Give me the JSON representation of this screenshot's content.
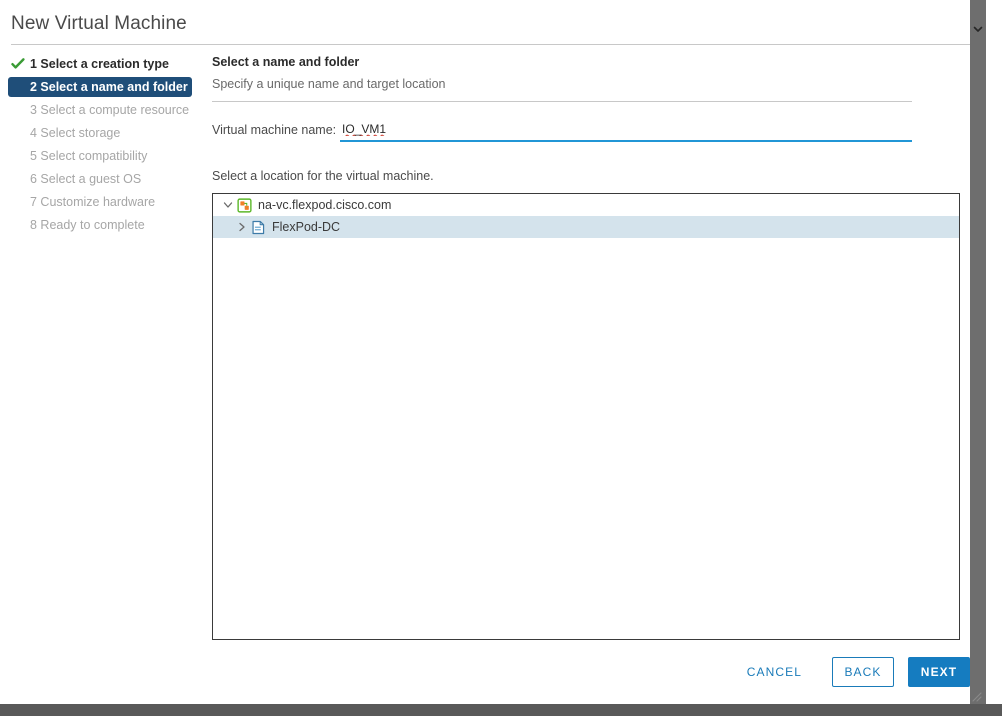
{
  "window": {
    "title": "New Virtual Machine"
  },
  "sidebar": {
    "steps": [
      {
        "label": "1 Select a creation type",
        "state": "done",
        "icon": "check-icon"
      },
      {
        "label": "2 Select a name and folder",
        "state": "active"
      },
      {
        "label": "3 Select a compute resource",
        "state": "pending"
      },
      {
        "label": "4 Select storage",
        "state": "pending"
      },
      {
        "label": "5 Select compatibility",
        "state": "pending"
      },
      {
        "label": "6 Select a guest OS",
        "state": "pending"
      },
      {
        "label": "7 Customize hardware",
        "state": "pending"
      },
      {
        "label": "8 Ready to complete",
        "state": "pending"
      }
    ]
  },
  "content": {
    "heading": "Select a name and folder",
    "subheading": "Specify a unique name and target location",
    "name_field": {
      "label": "Virtual machine name:",
      "value": "IO_VM1",
      "placeholder": ""
    },
    "location_label": "Select a location for the virtual machine.",
    "tree": [
      {
        "label": "na-vc.flexpod.cisco.com",
        "level": 0,
        "expanded": true,
        "selected": false,
        "icon": "vcenter-server-icon",
        "twisty": "chevron-down-icon"
      },
      {
        "label": "FlexPod-DC",
        "level": 1,
        "expanded": false,
        "selected": true,
        "icon": "datacenter-icon",
        "twisty": "chevron-right-icon"
      }
    ]
  },
  "footer": {
    "cancel_label": "CANCEL",
    "back_label": "BACK",
    "next_label": "NEXT"
  },
  "colors": {
    "active_step_bg": "#1f4e79",
    "primary_button_bg": "#157cc0",
    "link_blue": "#1a7bb9",
    "input_underline": "#2196d6",
    "selected_row_bg": "#d4e3ec",
    "check_green": "#3a9b35"
  }
}
